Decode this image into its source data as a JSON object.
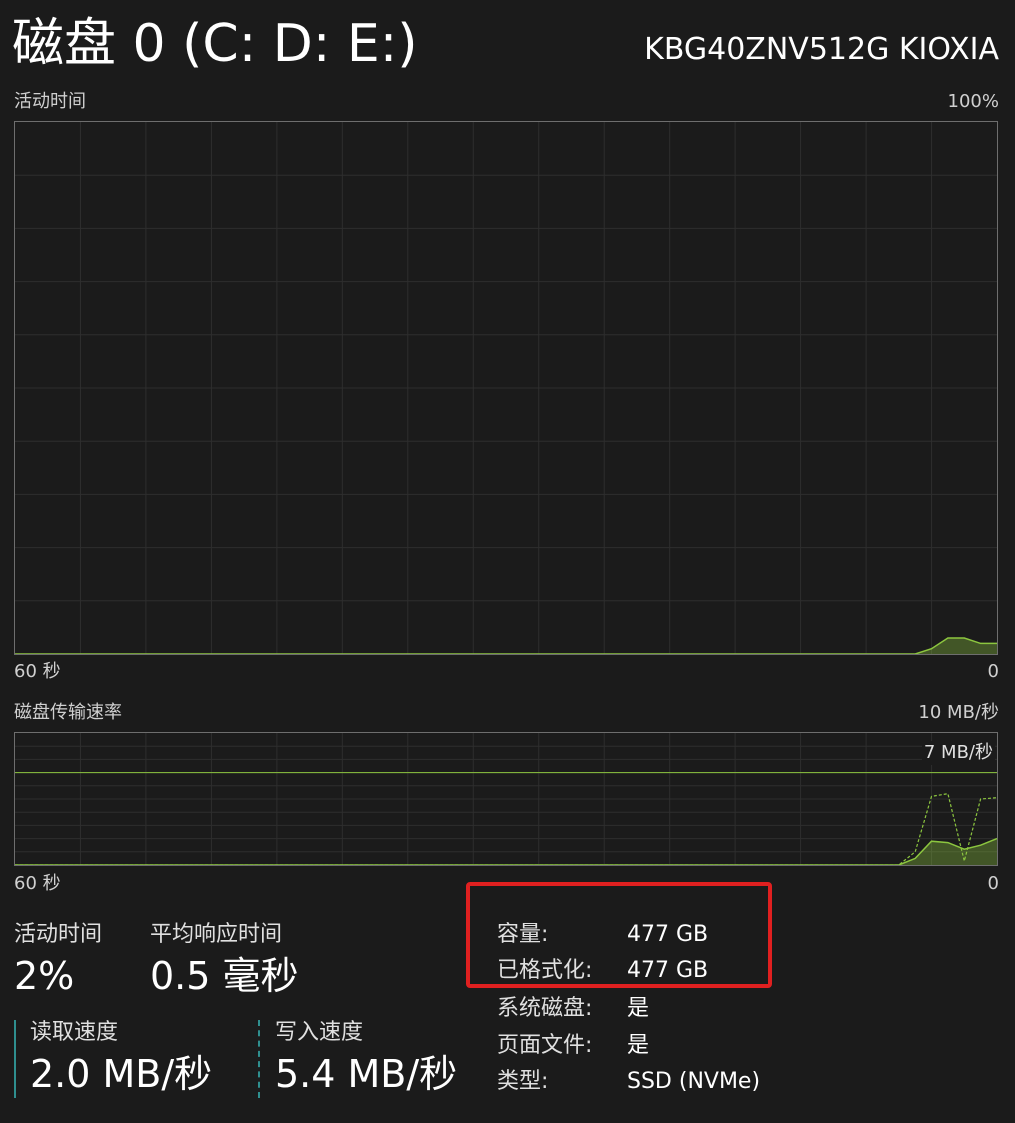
{
  "header": {
    "title": "磁盘 0 (C: D: E:)",
    "model": "KBG40ZNV512G KIOXIA"
  },
  "active_chart": {
    "label": "活动时间",
    "max_label": "100%",
    "x_left_label": "60 秒",
    "x_right_label": "0",
    "color": "#8cc63f"
  },
  "transfer_chart": {
    "label": "磁盘传输速率",
    "max_label": "10 MB/秒",
    "ref_line_label": "7 MB/秒",
    "x_left_label": "60 秒",
    "x_right_label": "0",
    "color": "#8cc63f"
  },
  "stats": {
    "active_time": {
      "label": "活动时间",
      "value": "2%"
    },
    "avg_response": {
      "label": "平均响应时间",
      "value": "0.5 毫秒"
    },
    "read_speed": {
      "label": "读取速度",
      "value": "2.0 MB/秒"
    },
    "write_speed": {
      "label": "写入速度",
      "value": "5.4 MB/秒"
    }
  },
  "properties": [
    {
      "label": "容量:",
      "value": "477 GB"
    },
    {
      "label": "已格式化:",
      "value": "477 GB"
    },
    {
      "label": "系统磁盘:",
      "value": "是"
    },
    {
      "label": "页面文件:",
      "value": "是"
    },
    {
      "label": "类型:",
      "value": "SSD (NVMe)"
    }
  ],
  "chart_data": [
    {
      "type": "area",
      "title": "活动时间",
      "xlabel": "60 秒 → 0",
      "ylim": [
        0,
        100
      ],
      "series": [
        {
          "values": [
            0,
            0,
            0,
            0,
            0,
            0,
            0,
            0,
            0,
            0,
            0,
            0,
            0,
            0,
            0,
            0,
            0,
            0,
            0,
            0,
            0,
            0,
            0,
            0,
            0,
            0,
            0,
            0,
            0,
            0,
            0,
            0,
            0,
            0,
            0,
            0,
            0,
            0,
            0,
            0,
            0,
            0,
            0,
            0,
            0,
            0,
            0,
            0,
            0,
            0,
            0,
            0,
            0,
            0,
            0,
            0,
            1,
            3,
            3,
            2,
            2
          ]
        }
      ]
    },
    {
      "type": "line",
      "title": "磁盘传输速率",
      "ylim": [
        0,
        10
      ],
      "reference_line": 7,
      "series": [
        {
          "name": "读取速度",
          "values": [
            0,
            0,
            0,
            0,
            0,
            0,
            0,
            0,
            0,
            0,
            0,
            0,
            0,
            0,
            0,
            0,
            0,
            0,
            0,
            0,
            0,
            0,
            0,
            0,
            0,
            0,
            0,
            0,
            0,
            0,
            0,
            0,
            0,
            0,
            0,
            0,
            0,
            0,
            0,
            0,
            0,
            0,
            0,
            0,
            0,
            0,
            0,
            0,
            0,
            0,
            0,
            0,
            0,
            0,
            0,
            0.5,
            1.8,
            1.7,
            1.2,
            1.5,
            2.0
          ]
        },
        {
          "name": "写入速度",
          "values": [
            0,
            0,
            0,
            0,
            0,
            0,
            0,
            0,
            0,
            0,
            0,
            0,
            0,
            0,
            0,
            0,
            0,
            0,
            0,
            0,
            0,
            0,
            0,
            0,
            0,
            0,
            0,
            0,
            0,
            0,
            0,
            0,
            0,
            0,
            0,
            0,
            0,
            0,
            0,
            0,
            0,
            0,
            0,
            0,
            0,
            0,
            0,
            0,
            0,
            0,
            0,
            0,
            0,
            0,
            0,
            1.0,
            5.2,
            5.4,
            0.3,
            5.0,
            5.1
          ]
        }
      ]
    }
  ]
}
